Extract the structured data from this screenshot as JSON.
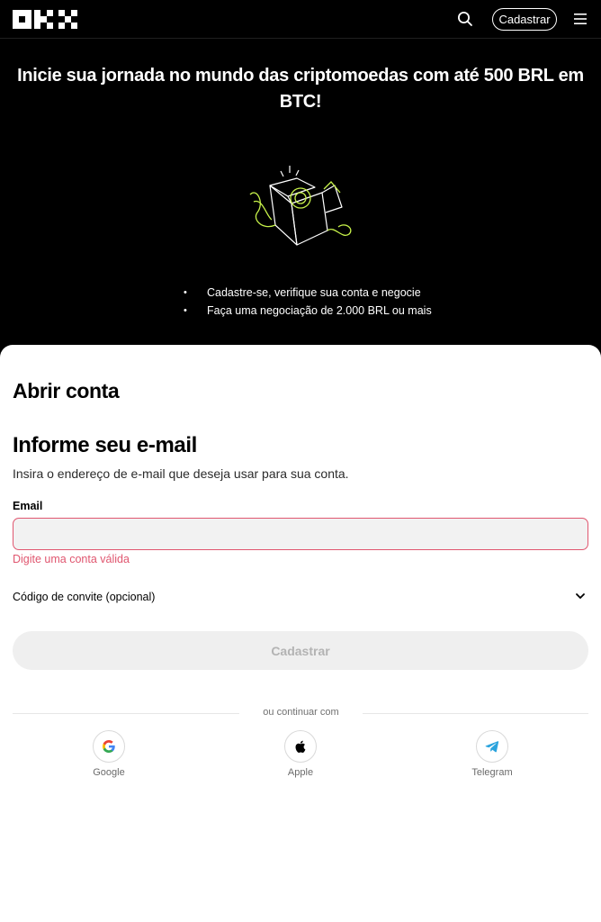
{
  "header": {
    "logo_icon": "okx-logo",
    "search_icon": "search-icon",
    "signup_label": "Cadastrar",
    "menu_icon": "menu-icon"
  },
  "hero": {
    "title": "Inicie sua jornada no mundo das criptomoedas com até 500 BRL em BTC!",
    "illustration_icon": "gift-box-icon",
    "bullets": [
      "Cadastre-se, verifique sua conta e negocie",
      "Faça uma negociação de  2.000  BRL ou mais"
    ]
  },
  "form": {
    "card_title": "Abrir conta",
    "section_title": "Informe seu e-mail",
    "section_subtitle": "Insira o endereço de e-mail que deseja usar para sua conta.",
    "email_label": "Email",
    "email_value": "",
    "email_error": "Digite uma conta válida",
    "invite_label": "Código de convite (opcional)",
    "submit_label": "Cadastrar",
    "divider_text": "ou continuar com",
    "social": [
      {
        "label": "Google",
        "icon": "google-icon"
      },
      {
        "label": "Apple",
        "icon": "apple-icon"
      },
      {
        "label": "Telegram",
        "icon": "telegram-icon"
      }
    ]
  },
  "colors": {
    "accent_green": "#c7f24a",
    "error_red": "#e0566f",
    "telegram_blue": "#2aa3dd"
  }
}
